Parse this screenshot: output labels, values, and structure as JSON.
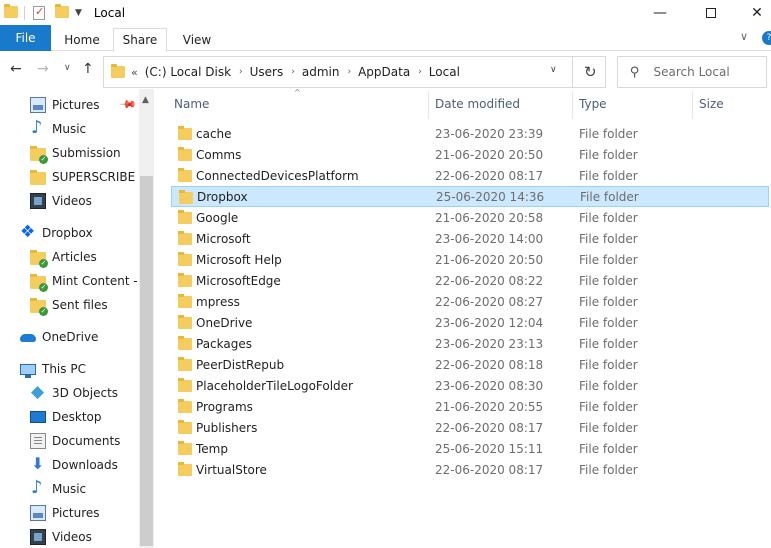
{
  "window": {
    "title": "Local",
    "controls": {
      "minimize": "—",
      "maximize": "",
      "close": "✕"
    }
  },
  "ribbon": {
    "tabs": [
      "File",
      "Home",
      "Share",
      "View"
    ],
    "active_tab": "Share",
    "collapse_glyph": "∨",
    "help_glyph": "?"
  },
  "navigation": {
    "back": "←",
    "forward": "→",
    "recent": "∨",
    "up": "↑",
    "address": {
      "overflow": "«",
      "crumbs": [
        "(C:) Local Disk",
        "Users",
        "admin",
        "AppData",
        "Local"
      ],
      "separator": "›",
      "dropdown": "∨",
      "refresh": "↻"
    },
    "search": {
      "placeholder": "Search Local"
    }
  },
  "nav_pane": {
    "items": [
      {
        "label": "Pictures",
        "icon": "pictures-icon",
        "pinned": true
      },
      {
        "label": "Music",
        "icon": "music-icon"
      },
      {
        "label": "Submission",
        "icon": "sync-folder-icon"
      },
      {
        "label": "SUPERSCRIBE",
        "icon": "folder-icon"
      },
      {
        "label": "Videos",
        "icon": "videos-icon"
      },
      {
        "label": "Dropbox",
        "icon": "dropbox-icon"
      },
      {
        "label": "Articles",
        "icon": "sync-folder-icon"
      },
      {
        "label": "Mint Content - S",
        "icon": "sync-folder-icon"
      },
      {
        "label": "Sent files",
        "icon": "sync-folder-icon"
      },
      {
        "label": "OneDrive",
        "icon": "onedrive-icon"
      },
      {
        "label": "This PC",
        "icon": "this-pc-icon"
      },
      {
        "label": "3D Objects",
        "icon": "3d-objects-icon"
      },
      {
        "label": "Desktop",
        "icon": "desktop-icon"
      },
      {
        "label": "Documents",
        "icon": "documents-icon"
      },
      {
        "label": "Downloads",
        "icon": "downloads-icon"
      },
      {
        "label": "Music",
        "icon": "music-icon"
      },
      {
        "label": "Pictures",
        "icon": "pictures-icon"
      },
      {
        "label": "Videos",
        "icon": "videos-icon"
      }
    ],
    "pin_glyph": "📌"
  },
  "file_list": {
    "columns": {
      "name": "Name",
      "date": "Date modified",
      "type": "Type",
      "size": "Size"
    },
    "sort_glyph": "^",
    "selected": "Dropbox",
    "rows": [
      {
        "name": "cache",
        "date": "23-06-2020 23:39",
        "type": "File folder"
      },
      {
        "name": "Comms",
        "date": "21-06-2020 20:50",
        "type": "File folder"
      },
      {
        "name": "ConnectedDevicesPlatform",
        "date": "22-06-2020 08:17",
        "type": "File folder"
      },
      {
        "name": "Dropbox",
        "date": "25-06-2020 14:36",
        "type": "File folder"
      },
      {
        "name": "Google",
        "date": "21-06-2020 20:58",
        "type": "File folder"
      },
      {
        "name": "Microsoft",
        "date": "23-06-2020 14:00",
        "type": "File folder"
      },
      {
        "name": "Microsoft Help",
        "date": "21-06-2020 20:50",
        "type": "File folder"
      },
      {
        "name": "MicrosoftEdge",
        "date": "22-06-2020 08:22",
        "type": "File folder"
      },
      {
        "name": "mpress",
        "date": "22-06-2020 08:27",
        "type": "File folder"
      },
      {
        "name": "OneDrive",
        "date": "23-06-2020 12:04",
        "type": "File folder"
      },
      {
        "name": "Packages",
        "date": "23-06-2020 23:13",
        "type": "File folder"
      },
      {
        "name": "PeerDistRepub",
        "date": "22-06-2020 08:18",
        "type": "File folder"
      },
      {
        "name": "PlaceholderTileLogoFolder",
        "date": "23-06-2020 08:30",
        "type": "File folder"
      },
      {
        "name": "Programs",
        "date": "21-06-2020 20:55",
        "type": "File folder"
      },
      {
        "name": "Publishers",
        "date": "22-06-2020 08:17",
        "type": "File folder"
      },
      {
        "name": "Temp",
        "date": "25-06-2020 15:11",
        "type": "File folder"
      },
      {
        "name": "VirtualStore",
        "date": "22-06-2020 08:17",
        "type": "File folder"
      }
    ]
  },
  "colors": {
    "file_tab": "#1979ca",
    "selection_fill": "#cce8ff",
    "selection_border": "#99d1ff",
    "folder": "#f4cd5e",
    "header_text": "#4c607a"
  }
}
